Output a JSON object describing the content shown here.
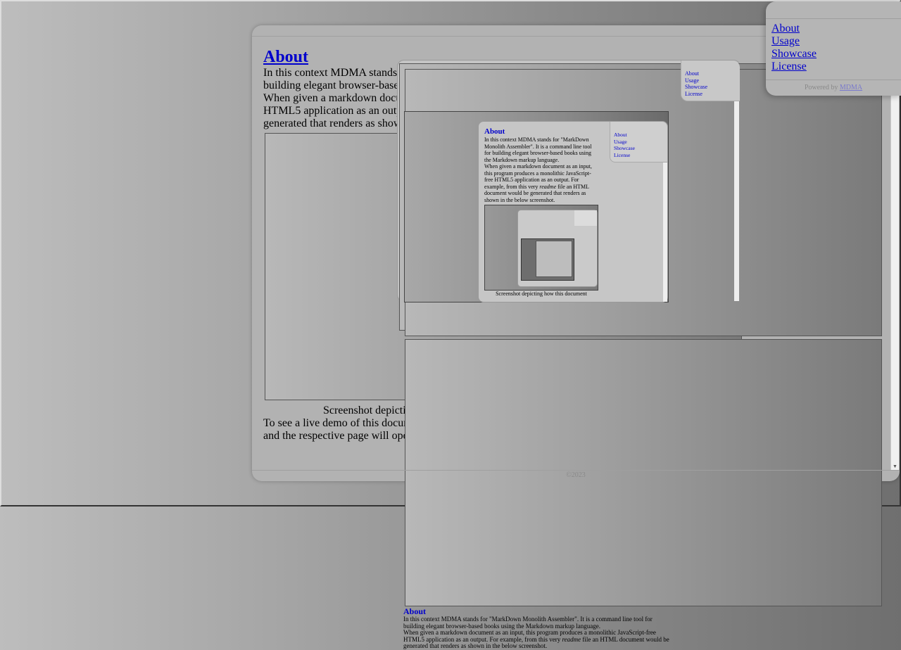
{
  "nav": {
    "items": [
      "About",
      "Usage",
      "Showcase",
      "License"
    ],
    "powered_prefix": "Powered by",
    "powered_link": "MDMA"
  },
  "main": {
    "title": "About",
    "p1": "In this context MDMA stands for \"MarkDown Monolith Assembler\". It is a command line tool for building elegant browser-based books using the Markdown markup language.",
    "p2_a": "When given a markdown document as an input, this program produces a monolithic JavaScript-free HTML5 application as an output. For example, from this very ",
    "p2_em": "readme",
    "p2_b": " file an HTML document would be generated that renders as shown in the below screenshot.",
    "caption": "Screenshot depicting how this document renders in the Chromium web browser",
    "p3": "To see a live demo of this document in the format of an HTML application, click on the above screenshot and the respective page will open in your web browser.",
    "footer": "©2023"
  },
  "screenshot": {
    "l1": {
      "title": "About",
      "p1": "In this context MDMA stands for \"MarkDown Monolith Assembler\". It is a command line tool for building elegant browser-based books using the Markdown markup language.",
      "p2_a": "When given a markdown document as an input, this program produces a monolithic JavaScript-free HTML5 application as an output. For example, from this very ",
      "p2_em": "readme",
      "p2_b": " file an HTML document would be generated that renders as shown in the below screenshot.",
      "nav": [
        "About",
        "Usage",
        "Showcase",
        "License"
      ]
    },
    "l2": {
      "title": "About",
      "p1": "In this context MDMA stands for \"MarkDown Monolith Assembler\". It is a command line tool for building elegant browser-based books using the Markdown markup language.",
      "p2_a": "When given a markdown document as an input, this program produces a monolithic JavaScript-free HTML5 application as an output. For example, from this very ",
      "p2_em": "readme",
      "p2_b": " file an HTML document would be generated that renders as shown in the below screenshot.",
      "caption": "Screenshot depicting how this document",
      "nav": [
        "About",
        "Usage",
        "Showcase",
        "License"
      ]
    }
  }
}
